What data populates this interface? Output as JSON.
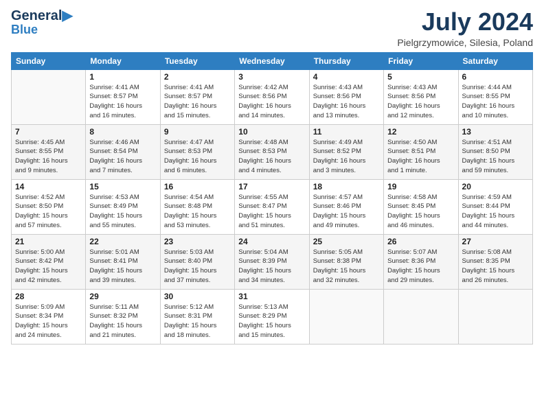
{
  "logo": {
    "line1": "General",
    "line2": "Blue"
  },
  "title": "July 2024",
  "location": "Pielgrzymowice, Silesia, Poland",
  "days_of_week": [
    "Sunday",
    "Monday",
    "Tuesday",
    "Wednesday",
    "Thursday",
    "Friday",
    "Saturday"
  ],
  "weeks": [
    [
      {
        "day": "",
        "info": ""
      },
      {
        "day": "1",
        "info": "Sunrise: 4:41 AM\nSunset: 8:57 PM\nDaylight: 16 hours\nand 16 minutes."
      },
      {
        "day": "2",
        "info": "Sunrise: 4:41 AM\nSunset: 8:57 PM\nDaylight: 16 hours\nand 15 minutes."
      },
      {
        "day": "3",
        "info": "Sunrise: 4:42 AM\nSunset: 8:56 PM\nDaylight: 16 hours\nand 14 minutes."
      },
      {
        "day": "4",
        "info": "Sunrise: 4:43 AM\nSunset: 8:56 PM\nDaylight: 16 hours\nand 13 minutes."
      },
      {
        "day": "5",
        "info": "Sunrise: 4:43 AM\nSunset: 8:56 PM\nDaylight: 16 hours\nand 12 minutes."
      },
      {
        "day": "6",
        "info": "Sunrise: 4:44 AM\nSunset: 8:55 PM\nDaylight: 16 hours\nand 10 minutes."
      }
    ],
    [
      {
        "day": "7",
        "info": "Sunrise: 4:45 AM\nSunset: 8:55 PM\nDaylight: 16 hours\nand 9 minutes."
      },
      {
        "day": "8",
        "info": "Sunrise: 4:46 AM\nSunset: 8:54 PM\nDaylight: 16 hours\nand 7 minutes."
      },
      {
        "day": "9",
        "info": "Sunrise: 4:47 AM\nSunset: 8:53 PM\nDaylight: 16 hours\nand 6 minutes."
      },
      {
        "day": "10",
        "info": "Sunrise: 4:48 AM\nSunset: 8:53 PM\nDaylight: 16 hours\nand 4 minutes."
      },
      {
        "day": "11",
        "info": "Sunrise: 4:49 AM\nSunset: 8:52 PM\nDaylight: 16 hours\nand 3 minutes."
      },
      {
        "day": "12",
        "info": "Sunrise: 4:50 AM\nSunset: 8:51 PM\nDaylight: 16 hours\nand 1 minute."
      },
      {
        "day": "13",
        "info": "Sunrise: 4:51 AM\nSunset: 8:50 PM\nDaylight: 15 hours\nand 59 minutes."
      }
    ],
    [
      {
        "day": "14",
        "info": "Sunrise: 4:52 AM\nSunset: 8:50 PM\nDaylight: 15 hours\nand 57 minutes."
      },
      {
        "day": "15",
        "info": "Sunrise: 4:53 AM\nSunset: 8:49 PM\nDaylight: 15 hours\nand 55 minutes."
      },
      {
        "day": "16",
        "info": "Sunrise: 4:54 AM\nSunset: 8:48 PM\nDaylight: 15 hours\nand 53 minutes."
      },
      {
        "day": "17",
        "info": "Sunrise: 4:55 AM\nSunset: 8:47 PM\nDaylight: 15 hours\nand 51 minutes."
      },
      {
        "day": "18",
        "info": "Sunrise: 4:57 AM\nSunset: 8:46 PM\nDaylight: 15 hours\nand 49 minutes."
      },
      {
        "day": "19",
        "info": "Sunrise: 4:58 AM\nSunset: 8:45 PM\nDaylight: 15 hours\nand 46 minutes."
      },
      {
        "day": "20",
        "info": "Sunrise: 4:59 AM\nSunset: 8:44 PM\nDaylight: 15 hours\nand 44 minutes."
      }
    ],
    [
      {
        "day": "21",
        "info": "Sunrise: 5:00 AM\nSunset: 8:42 PM\nDaylight: 15 hours\nand 42 minutes."
      },
      {
        "day": "22",
        "info": "Sunrise: 5:01 AM\nSunset: 8:41 PM\nDaylight: 15 hours\nand 39 minutes."
      },
      {
        "day": "23",
        "info": "Sunrise: 5:03 AM\nSunset: 8:40 PM\nDaylight: 15 hours\nand 37 minutes."
      },
      {
        "day": "24",
        "info": "Sunrise: 5:04 AM\nSunset: 8:39 PM\nDaylight: 15 hours\nand 34 minutes."
      },
      {
        "day": "25",
        "info": "Sunrise: 5:05 AM\nSunset: 8:38 PM\nDaylight: 15 hours\nand 32 minutes."
      },
      {
        "day": "26",
        "info": "Sunrise: 5:07 AM\nSunset: 8:36 PM\nDaylight: 15 hours\nand 29 minutes."
      },
      {
        "day": "27",
        "info": "Sunrise: 5:08 AM\nSunset: 8:35 PM\nDaylight: 15 hours\nand 26 minutes."
      }
    ],
    [
      {
        "day": "28",
        "info": "Sunrise: 5:09 AM\nSunset: 8:34 PM\nDaylight: 15 hours\nand 24 minutes."
      },
      {
        "day": "29",
        "info": "Sunrise: 5:11 AM\nSunset: 8:32 PM\nDaylight: 15 hours\nand 21 minutes."
      },
      {
        "day": "30",
        "info": "Sunrise: 5:12 AM\nSunset: 8:31 PM\nDaylight: 15 hours\nand 18 minutes."
      },
      {
        "day": "31",
        "info": "Sunrise: 5:13 AM\nSunset: 8:29 PM\nDaylight: 15 hours\nand 15 minutes."
      },
      {
        "day": "",
        "info": ""
      },
      {
        "day": "",
        "info": ""
      },
      {
        "day": "",
        "info": ""
      }
    ]
  ]
}
